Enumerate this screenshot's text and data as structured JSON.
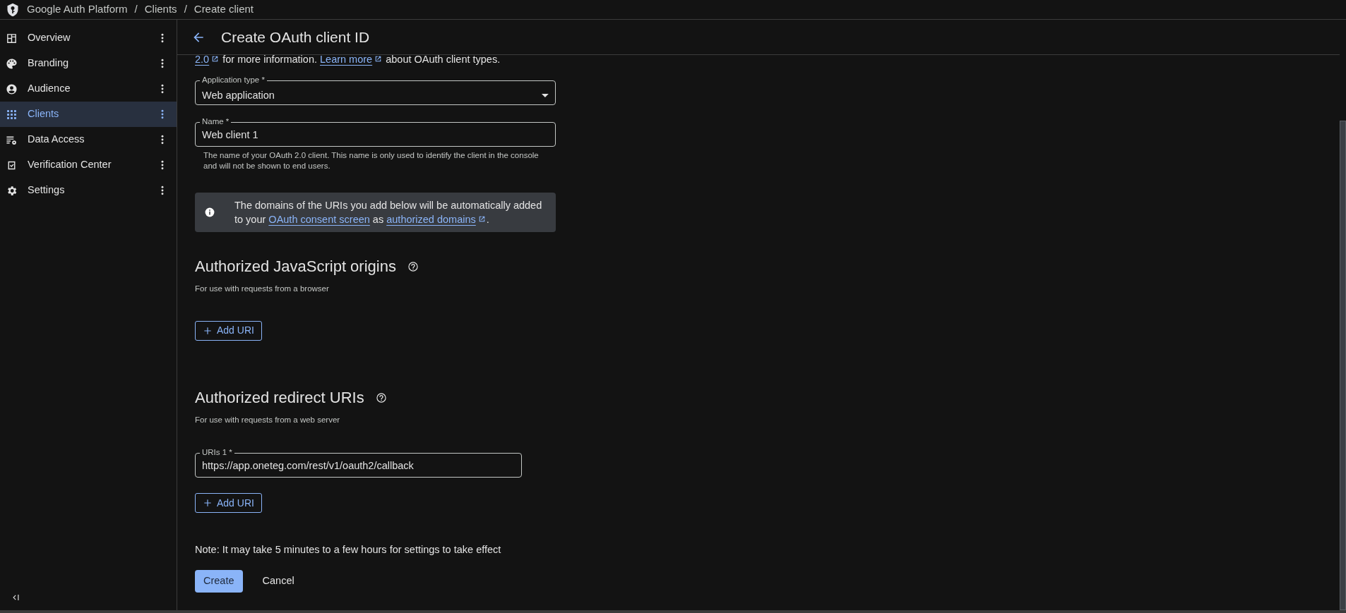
{
  "header": {
    "breadcrumbs": [
      "Google Auth Platform",
      "Clients",
      "Create client"
    ],
    "separators": [
      "/",
      "/"
    ]
  },
  "sidebar": {
    "items": [
      {
        "label": "Overview",
        "selected": false
      },
      {
        "label": "Branding",
        "selected": false
      },
      {
        "label": "Audience",
        "selected": false
      },
      {
        "label": "Clients",
        "selected": true
      },
      {
        "label": "Data Access",
        "selected": false
      },
      {
        "label": "Verification Center",
        "selected": false
      },
      {
        "label": "Settings",
        "selected": false
      }
    ]
  },
  "page": {
    "title": "Create OAuth client ID"
  },
  "intro": [
    {
      "kind": "link",
      "text": "2.0",
      "external": true
    },
    {
      "kind": "text",
      "text": " for more information. "
    },
    {
      "kind": "link",
      "text": "Learn more",
      "external": true
    },
    {
      "kind": "text",
      "text": " about OAuth client types."
    }
  ],
  "application_type": {
    "label": "Application type *",
    "value": "Web application"
  },
  "name_field": {
    "label": "Name *",
    "value": "Web client 1",
    "helper": "The name of your OAuth 2.0 client. This name is only used to identify the client in the console and will not be shown to end users."
  },
  "info_banner": [
    {
      "kind": "text",
      "text": "The domains of the URIs you add below will be automatically added to your "
    },
    {
      "kind": "link",
      "text": "OAuth consent screen",
      "external": false
    },
    {
      "kind": "text",
      "text": " as "
    },
    {
      "kind": "link",
      "text": "authorized domains",
      "external": true
    },
    {
      "kind": "text",
      "text": "."
    }
  ],
  "sections": [
    {
      "title": "Authorized JavaScript origins",
      "description": "For use with requests from a browser",
      "add_button": "Add URI"
    },
    {
      "title": "Authorized redirect URIs",
      "description": "For use with requests from a web server",
      "uris": [
        {
          "label": "URIs 1 *",
          "value": "https://app.oneteg.com/rest/v1/oauth2/callback"
        }
      ],
      "add_button": "Add URI"
    }
  ],
  "note": "Note: It may take 5 minutes to a few hours for settings to take effect",
  "actions": {
    "primary": "Create",
    "secondary": "Cancel"
  }
}
